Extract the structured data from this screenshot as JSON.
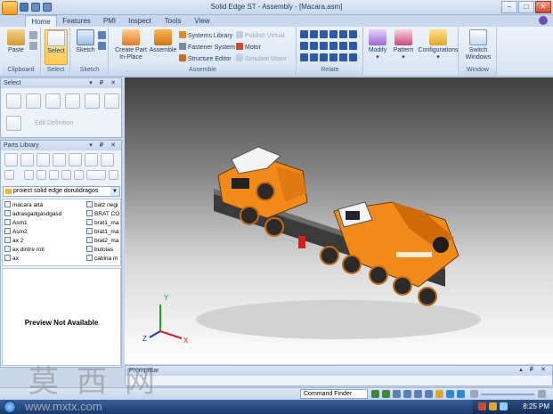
{
  "window": {
    "title": "Solid Edge ST - Assembly - [Macara.asm]",
    "controls": [
      "–",
      "□",
      "✕"
    ]
  },
  "tabs": [
    "Home",
    "Features",
    "PMI",
    "Inspect",
    "Tools",
    "View"
  ],
  "ribbon": {
    "groups": {
      "clipboard": "Clipboard",
      "select": "Select",
      "sketch": "Sketch",
      "assemble": "Assemble",
      "relate": "Relate",
      "window": "Window"
    },
    "buttons": {
      "paste": "Paste",
      "select": "Select",
      "sketch": "Sketch",
      "create_part_line1": "Create Part",
      "create_part_line2": "In-Place",
      "assemble": "Assemble",
      "systems_library": "Systems Library",
      "fastener_system": "Fastener System",
      "structure_editor": "Structure Editor",
      "publish_virtual": "Publish Virtual",
      "motor": "Motor",
      "simulate_motor": "Simulate Motor",
      "modify": "Modify",
      "pattern": "Pattern",
      "configurations": "Configurations",
      "switch_windows_line1": "Switch",
      "switch_windows_line2": "Windows"
    }
  },
  "select_panel": {
    "title": "Select",
    "edit_definition": "Edit Definition"
  },
  "parts_library": {
    "title": "Parts Library",
    "folder": "proiect solid edge dorulidragos",
    "files_col1": [
      "macara alta",
      "adrasgadgasdgasd",
      "Asm1",
      "Asm2",
      "ax 2",
      "ax dintre roti",
      "ax"
    ],
    "files_col2": [
      "batz negi",
      "BRAT CO",
      "brat1_ma",
      "brat1_ma",
      "brat2_ma",
      "butoias",
      "cabina m"
    ],
    "preview_text": "Preview Not Available"
  },
  "viewport": {
    "triad": {
      "x": "X",
      "y": "Y",
      "z": "Z"
    }
  },
  "prompt_bar": {
    "title": "PromptBar"
  },
  "status_bar": {
    "command_finder": "Command Finder"
  },
  "taskbar": {
    "clock": "8:25 PM"
  },
  "watermark": {
    "chars": "莫西网",
    "url": "www.mxtx.com"
  },
  "colors": {
    "ribbon_accent": "#c6d7ee",
    "model_orange": "#f28a1a",
    "viewport_top": "#3f3f3f"
  }
}
